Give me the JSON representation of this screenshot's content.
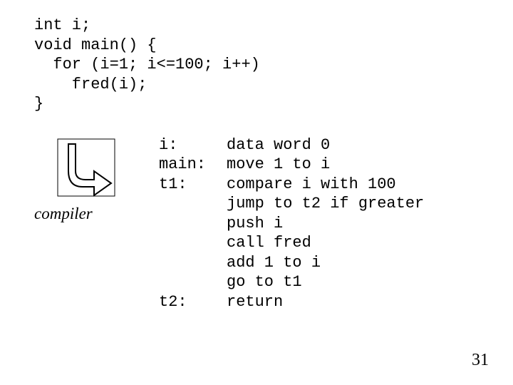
{
  "source_code": {
    "line1": "int i;",
    "line2": "void main() {",
    "line3": "  for (i=1; i<=100; i++)",
    "line4": "    fred(i);",
    "line5": "}"
  },
  "compiler_label": "compiler",
  "asm": {
    "labels": "i:\nmain:\nt1:\n\n\n\n\n\nt2:",
    "body": "data word 0\nmove 1 to i\ncompare i with 100\njump to t2 if greater\npush i\ncall fred\nadd 1 to i\ngo to t1\nreturn"
  },
  "page_number": "31"
}
